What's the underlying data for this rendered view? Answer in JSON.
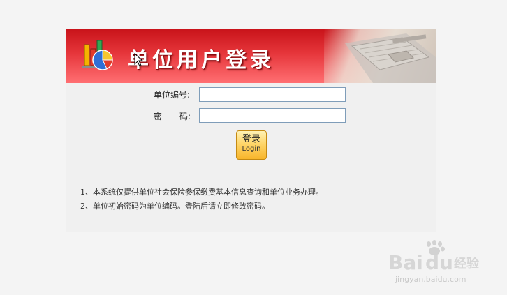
{
  "banner": {
    "title": "单位用户登录"
  },
  "form": {
    "unit_id_label": "单位编号:",
    "password_label_left": "密",
    "password_label_right": "码:",
    "unit_id_value": "",
    "password_value": ""
  },
  "login_button": {
    "label_cn": "登录",
    "label_en": "Login"
  },
  "notes": [
    "1、本系统仅提供单位社会保险参保缴费基本信息查询和单位业务办理。",
    "2、单位初始密码为单位编码。登陆后请立即修改密码。"
  ],
  "watermark": {
    "domain": "jingyan.baidu.com"
  },
  "colors": {
    "banner_red": "#e6363b",
    "button_gold": "#ffd66a",
    "input_border": "#7f9db9"
  }
}
